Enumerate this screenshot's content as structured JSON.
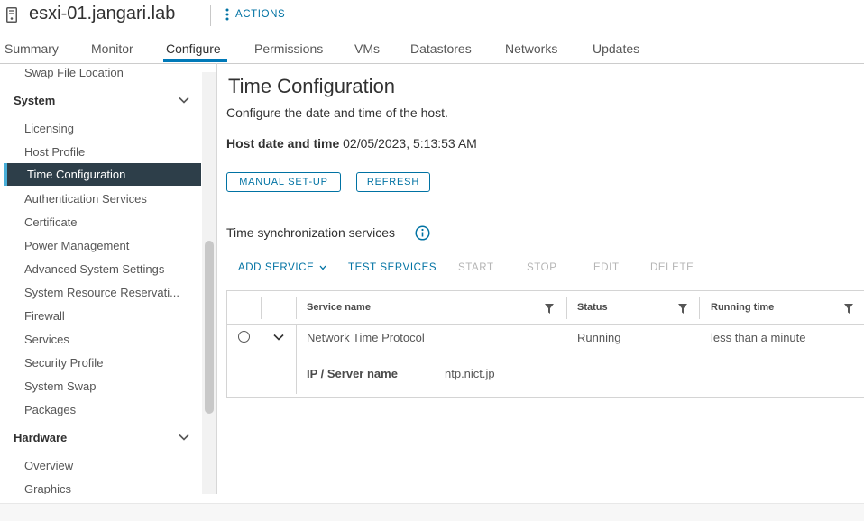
{
  "header": {
    "host_name": "esxi-01.jangari.lab",
    "actions_label": "ACTIONS"
  },
  "tabs": [
    {
      "label": "Summary"
    },
    {
      "label": "Monitor"
    },
    {
      "label": "Configure",
      "active": true
    },
    {
      "label": "Permissions"
    },
    {
      "label": "VMs"
    },
    {
      "label": "Datastores"
    },
    {
      "label": "Networks"
    },
    {
      "label": "Updates"
    }
  ],
  "sidebar": {
    "partial_item": "Swap File Location",
    "system_group": "System",
    "system_items": [
      "Licensing",
      "Host Profile",
      "Time Configuration",
      "Authentication Services",
      "Certificate",
      "Power Management",
      "Advanced System Settings",
      "System Resource Reservati...",
      "Firewall",
      "Services",
      "Security Profile",
      "System Swap",
      "Packages"
    ],
    "hardware_group": "Hardware",
    "hardware_items": [
      "Overview",
      "Graphics"
    ]
  },
  "main": {
    "title": "Time Configuration",
    "description": "Configure the date and time of the host.",
    "host_dt_label": "Host date and time",
    "host_dt_value": "02/05/2023, 5:13:53 AM",
    "manual_setup_label": "MANUAL SET-UP",
    "refresh_label": "REFRESH",
    "sync_title": "Time synchronization services",
    "actions": {
      "add_service": "ADD SERVICE",
      "test_services": "TEST SERVICES",
      "start": "START",
      "stop": "STOP",
      "edit": "EDIT",
      "delete": "DELETE"
    },
    "grid": {
      "columns": [
        "Service name",
        "Status",
        "Running time"
      ],
      "rows": [
        {
          "service_name": "Network Time Protocol",
          "status": "Running",
          "running_time": "less than a minute",
          "detail_label": "IP / Server name",
          "detail_value": "ntp.nict.jp"
        }
      ]
    }
  },
  "colors": {
    "accent": "#0072a3",
    "selected_bg": "#2d3e49",
    "selected_bar": "#49afd9",
    "tab_underline": "#0079b8"
  }
}
